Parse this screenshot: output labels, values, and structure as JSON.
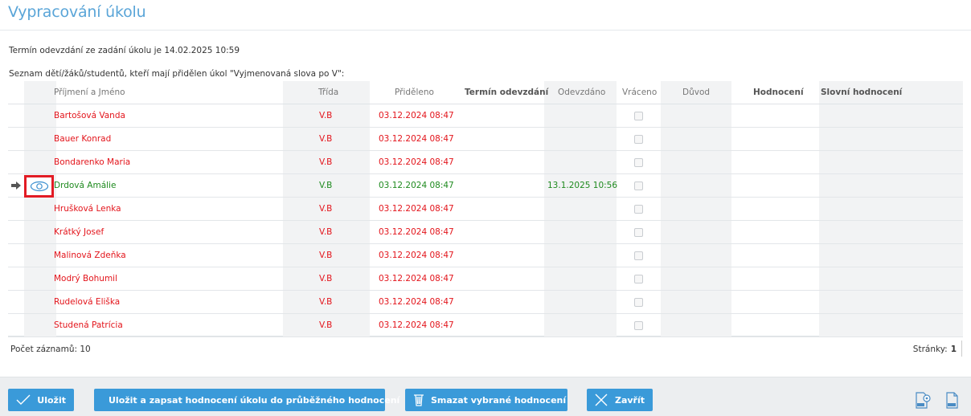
{
  "page": {
    "title": "Vypracování úkolu"
  },
  "deadline_info": "Termín odevzdání ze zadání úkolu je 14.02.2025 10:59",
  "list_caption": "Seznam dětí/žáků/studentů, kteří mají přidělen úkol \"Vyjmenovaná slova po V\":",
  "table": {
    "headers": {
      "name": "Příjmení a Jméno",
      "class": "Třída",
      "assigned": "Přiděleno",
      "deadline": "Termín odevzdání",
      "submitted": "Odevzdáno",
      "returned": "Vráceno",
      "reason": "Důvod",
      "grade": "Hodnocení",
      "verbal": "Slovní hodnocení"
    },
    "rows": [
      {
        "name": "Bartošová Vanda",
        "class": "V.B",
        "assigned": "03.12.2024 08:47",
        "submitted": "",
        "status": "red"
      },
      {
        "name": "Bauer Konrad",
        "class": "V.B",
        "assigned": "03.12.2024 08:47",
        "submitted": "",
        "status": "red"
      },
      {
        "name": "Bondarenko Maria",
        "class": "V.B",
        "assigned": "03.12.2024 08:47",
        "submitted": "",
        "status": "red"
      },
      {
        "name": "Drdová Amálie",
        "class": "V.B",
        "assigned": "03.12.2024 08:47",
        "submitted": "13.1.2025 10:56",
        "status": "green"
      },
      {
        "name": "Hrušková Lenka",
        "class": "V.B",
        "assigned": "03.12.2024 08:47",
        "submitted": "",
        "status": "red"
      },
      {
        "name": "Krátký Josef",
        "class": "V.B",
        "assigned": "03.12.2024 08:47",
        "submitted": "",
        "status": "red"
      },
      {
        "name": "Malinová Zdeňka",
        "class": "V.B",
        "assigned": "03.12.2024 08:47",
        "submitted": "",
        "status": "red"
      },
      {
        "name": "Modrý Bohumil",
        "class": "V.B",
        "assigned": "03.12.2024 08:47",
        "submitted": "",
        "status": "red"
      },
      {
        "name": "Rudelová Eliška",
        "class": "V.B",
        "assigned": "03.12.2024 08:47",
        "submitted": "",
        "status": "red"
      },
      {
        "name": "Studená Patrícia",
        "class": "V.B",
        "assigned": "03.12.2024 08:47",
        "submitted": "",
        "status": "red"
      }
    ]
  },
  "footer": {
    "record_count": "Počet záznamů: 10",
    "pages_label": "Stránky:",
    "current_page": "1"
  },
  "actions": {
    "save": "Uložit",
    "save_and_record": "Uložit a zapsat hodnocení úkolu do průběžného hodnocení",
    "delete_selected": "Smazat vybrané hodnocení",
    "close": "Zavřít"
  },
  "icons": {
    "row_marker": "arrow-right-icon",
    "preview": "eye-icon",
    "export_settings": "gear-document-icon",
    "export_xls": "xls-file-icon"
  },
  "colors": {
    "title": "#5aa5d8",
    "not_submitted": "#e3141b",
    "submitted": "#1e8a1e",
    "button": "#3a9ad9",
    "highlight_frame": "#e21b24"
  }
}
